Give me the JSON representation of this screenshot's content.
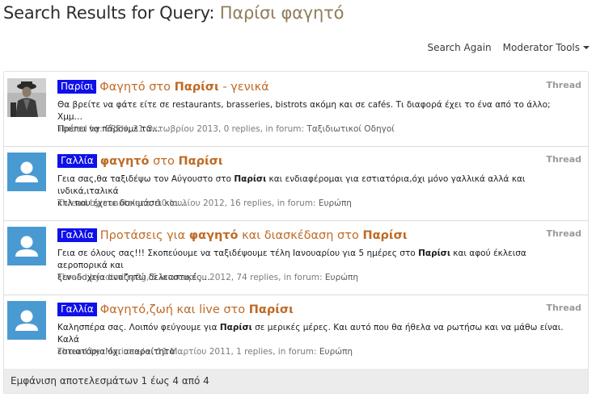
{
  "page": {
    "title_prefix": "Search Results for Query:",
    "query": "Παρίσι φαγητό"
  },
  "tools": {
    "search_again": "Search Again",
    "moderator_tools": "Moderator Tools"
  },
  "results": [
    {
      "prefix": "Παρίσι",
      "title_parts": [
        "Φαγητό στο ",
        "Παρίσι",
        " - γενικά"
      ],
      "type_label": "Thread",
      "snippet_line1": "Θα βρείτε να φάτε είτε σε restaurants, brasseries, bistrots ακόμη και σε cafés. Τι διαφορά έχει το ένα από το άλλο; Χμμ…",
      "snippet_line2": "Πρέπει να πάρουμε τα…",
      "meta_text": "Thread by: ΕΡΣΗ, 31 Οκτωβρίου 2013, 0 replies, in forum: ",
      "forum": "Ταξιδιωτικοί Οδηγοί",
      "avatar": "photo-avatar"
    },
    {
      "prefix": "Γαλλία",
      "title_parts": [
        "φαγητό",
        " στο ",
        "Παρίσι"
      ],
      "type_label": "Thread",
      "snippet_pre": "Γεια σας,θα ταξιδέψω τον Αύγουστο στο ",
      "snippet_bold": "Παρίσι",
      "snippet_post": " και ενδιαφέρομαι για εστιατόρια,όχι μόνο γαλλικά αλλά και ινδικά,ιταλικά",
      "snippet_line2": "κτλ που έχετε δοκιμάσει και…",
      "meta_text": "Thread by: mantalena, 10 Ιουλίου 2012, 16 replies, in forum: ",
      "forum": "Ευρώπη",
      "avatar": "default-avatar"
    },
    {
      "prefix": "Γαλλία",
      "title_parts": [
        "Προτάσεις για ",
        "φαγητό",
        " και διασκέδαση στο ",
        "Παρίσι"
      ],
      "type_label": "Thread",
      "snippet_pre": "Γεια σε όλους σας!!! Σκοπεύουμε να ταξιδέψουμε τέλη Ιανουαρίου για 5 ημέρες στο ",
      "snippet_bold": "Παρίσι",
      "snippet_post": " και αφού έκλεισα αεροπορικά και",
      "snippet_line2": "ξενοδοχεία αναζητώ δελεαστικές…",
      "meta_text": "Thread by: dimitra2g, 5 Ιανουαρίου 2012, 74 replies, in forum: ",
      "forum": "Ευρώπη",
      "avatar": "default-avatar"
    },
    {
      "prefix": "Γαλλία",
      "title_parts": [
        "Φαγητό,ζωή και live στο ",
        "Παρίσι"
      ],
      "type_label": "Thread",
      "snippet_pre": "Καλησπέρα σας. Λοιπόν φεύγουμε για ",
      "snippet_bold": "Παρίσι",
      "snippet_post": " σε μερικές μέρες. Και αυτό που θα ήθελα να ρωτήσω και να μάθω είναι. Καλά",
      "snippet_line2": "εστιατόρια όχι απαραίτητα…",
      "meta_text": "Thread by: Marina~/~, 11 Μαρτίου 2011, 1 replies, in forum: ",
      "forum": "Ευρώπη",
      "avatar": "default-avatar"
    }
  ],
  "footer": {
    "summary": "Εμφάνιση αποτελεσμάτων 1 έως 4 από 4"
  },
  "colors": {
    "prefix_bg": "#1010ea",
    "title": "#c06a24",
    "avatar": "#4a9ad2"
  }
}
